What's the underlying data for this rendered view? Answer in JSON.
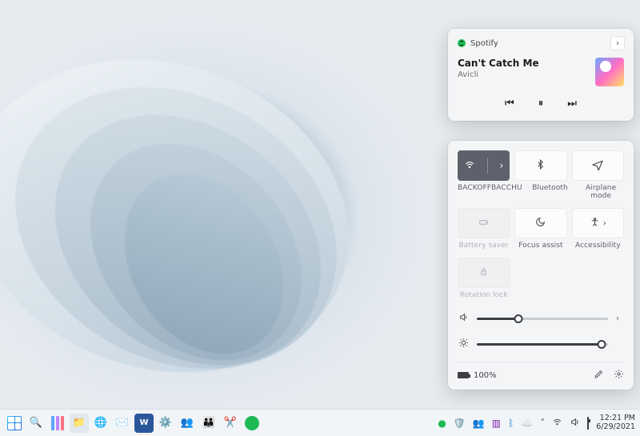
{
  "media": {
    "app_name": "Spotify",
    "track_title": "Can't Catch Me",
    "track_artist": "Avicli"
  },
  "quick": {
    "toggles": [
      {
        "label": "BACKOFFBACCHU"
      },
      {
        "label": "Bluetooth"
      },
      {
        "label": "Airplane mode"
      },
      {
        "label": "Battery saver"
      },
      {
        "label": "Focus assist"
      },
      {
        "label": "Accessibility"
      },
      {
        "label": "Rotation lock"
      }
    ],
    "volume_percent": 32,
    "brightness_percent": 95,
    "battery_text": "100%"
  },
  "taskbar": {
    "time": "12:21 PM",
    "date": "6/29/2021"
  }
}
